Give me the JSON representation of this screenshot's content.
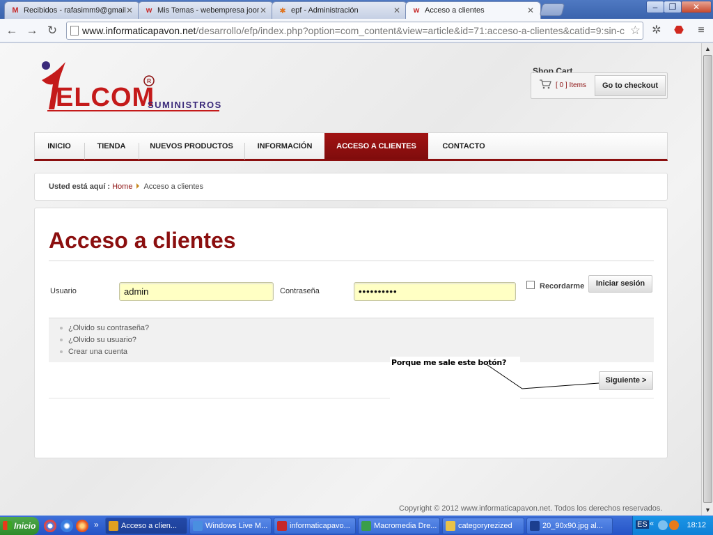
{
  "browser": {
    "tabs": [
      {
        "title": "Recibidos - rafasimm9@gmail.",
        "icon": "gmail-icon",
        "active": false
      },
      {
        "title": "Mis Temas - webempresa joor",
        "icon": "webempresa-icon",
        "active": false
      },
      {
        "title": "epf - Administración",
        "icon": "joomla-icon",
        "active": false
      },
      {
        "title": "Acceso a clientes",
        "icon": "webempresa-icon",
        "active": true
      }
    ],
    "window_controls": {
      "minimize": "–",
      "maximize": "❐",
      "close": "✕"
    },
    "url_host": "www.informaticapavon.net",
    "url_path": "/desarrollo/efp/index.php?option=com_content&view=article&id=71:acceso-a-clientes&catid=9:sin-c"
  },
  "site": {
    "logo": {
      "brand": "ELCOM",
      "letter": "T",
      "sub": "SUMINISTROS"
    },
    "cart": {
      "title": "Shop Cart",
      "items": "[ 0 ] Items",
      "checkout": "Go to checkout"
    },
    "nav": [
      {
        "label": "INICIO"
      },
      {
        "label": "TIENDA"
      },
      {
        "label": "NUEVOS PRODUCTOS"
      },
      {
        "label": "INFORMACIÓN"
      },
      {
        "label": "ACCESO A CLIENTES",
        "active": true
      },
      {
        "label": "CONTACTO"
      }
    ],
    "breadcrumb": {
      "prefix": "Usted está aquí :",
      "home": "Home",
      "current": "Acceso a clientes"
    },
    "page_title": "Acceso a clientes",
    "login": {
      "user_label": "Usuario",
      "user_value": "admin",
      "pass_label": "Contraseña",
      "pass_value": "••••••••••",
      "remember": "Recordarme",
      "submit": "Iniciar sesión",
      "links": [
        "¿Olvido su contraseña?",
        "¿Olvido su usuario?",
        "Crear una cuenta"
      ],
      "next": "Siguiente >"
    },
    "annotation": "Porque me sale este botón?",
    "footer": "Copyright © 2012 www.informaticapavon.net. Todos los derechos reservados."
  },
  "taskbar": {
    "start": "Inicio",
    "windows": [
      {
        "label": "Acceso a clien...",
        "active": true,
        "color": "#e0a020"
      },
      {
        "label": "Windows Live M...",
        "active": false,
        "color": "#4a8fe0"
      },
      {
        "label": "informaticapavo...",
        "active": false,
        "color": "#c62828"
      },
      {
        "label": "Macromedia Dre...",
        "active": false,
        "color": "#3a9e4a"
      },
      {
        "label": "categoryrezized",
        "active": false,
        "color": "#e8c24a"
      },
      {
        "label": "20_90x90.jpg al...",
        "active": false,
        "color": "#1c3f8f"
      }
    ],
    "tray": {
      "lang": "ES",
      "time": "18:12"
    }
  },
  "colors": {
    "brand": "#8b0f0f",
    "field_bg": "#ffffc4"
  }
}
